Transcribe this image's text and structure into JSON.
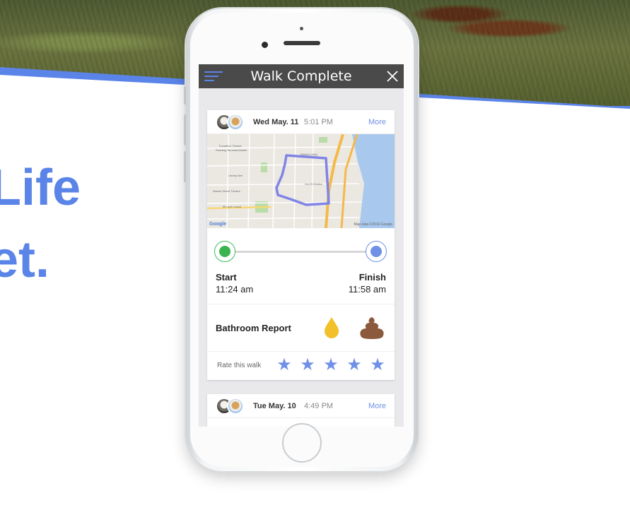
{
  "hero": {
    "headline_line1": "Life",
    "headline_line2": "et."
  },
  "app": {
    "title": "Walk Complete"
  },
  "walks": [
    {
      "date": "Wed May. 11",
      "time": "5:01 PM",
      "more_label": "More",
      "start_label": "Start",
      "start_time": "11:24 am",
      "finish_label": "Finish",
      "finish_time": "11:58 am",
      "bathroom_label": "Bathroom Report",
      "rating_label": "Rate this walk",
      "rating": 5
    },
    {
      "date": "Tue May. 10",
      "time": "4:49 PM",
      "more_label": "More"
    }
  ],
  "map": {
    "attribution_logo": "Google",
    "credit": "Map data ©2016 Google"
  },
  "colors": {
    "accent": "#5b84e8",
    "start": "#39b44f",
    "finish": "#6f90e6",
    "pee": "#f2c02a",
    "poop": "#8b5a3c"
  },
  "icons": [
    "menu-icon",
    "close-icon",
    "pee-drop-icon",
    "poop-icon",
    "star-icon"
  ]
}
